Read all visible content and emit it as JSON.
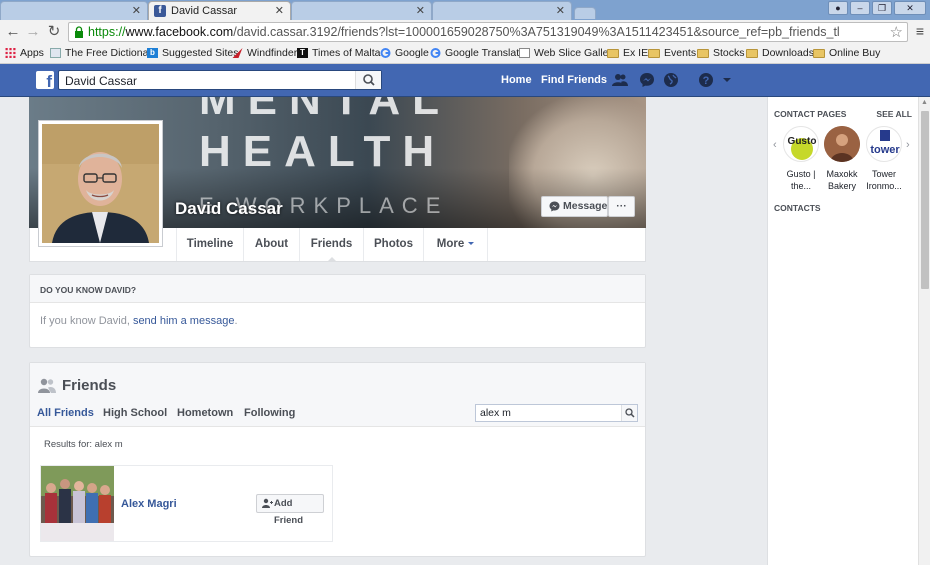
{
  "browser": {
    "tabs": [
      {
        "title": "",
        "active": false
      },
      {
        "title": "David Cassar",
        "active": true
      },
      {
        "title": "",
        "active": false
      },
      {
        "title": "",
        "active": false
      }
    ],
    "url": {
      "proto": "https://",
      "host": "www.facebook.com",
      "path": "/david.cassar.3192/friends?lst=100001659028750%3A751319049%3A1511423451&source_ref=pb_friends_tl"
    },
    "bookmarks": [
      "Apps",
      "The Free Dictionary",
      "Suggested Sites",
      "Windfinder",
      "Times of Malta",
      "Google",
      "Google Translate",
      "Web Slice Gallery",
      "Ex IE",
      "Events",
      "Stocks",
      "Downloads",
      "Online Buy"
    ]
  },
  "fb_header": {
    "search_value": "David Cassar",
    "links": [
      "Home",
      "Find Friends"
    ]
  },
  "profile": {
    "name": "David Cassar",
    "cover_text": [
      "MENTAL",
      "HEALTH",
      "E WORKPLACE"
    ],
    "message_button": "Message",
    "more_button": "···",
    "tabs": [
      "Timeline",
      "About",
      "Friends",
      "Photos",
      "More"
    ],
    "active_tab": "Friends"
  },
  "know_card": {
    "heading": "DO YOU KNOW DAVID?",
    "text_prefix": "If you know David, ",
    "link_text": "send him a message",
    "text_suffix": "."
  },
  "friends": {
    "title": "Friends",
    "tabs": [
      "All Friends",
      "High School",
      "Hometown",
      "Following"
    ],
    "active_tab": "All Friends",
    "search_value": "alex m",
    "results_label": "Results for: alex m",
    "results": [
      {
        "name": "Alex Magri",
        "action": "Add Friend"
      }
    ]
  },
  "sidebar": {
    "contact_pages_label": "CONTACT PAGES",
    "see_all_label": "SEE ALL",
    "pages": [
      {
        "line1": "Gusto |",
        "line2": "the...",
        "logo_text": "Gusto"
      },
      {
        "line1": "Maxokk",
        "line2": "Bakery",
        "logo_text": ""
      },
      {
        "line1": "Tower",
        "line2": "Ironmo...",
        "logo_text": "tower"
      }
    ],
    "contacts_label": "CONTACTS"
  },
  "colors": {
    "fb_blue": "#4267b2",
    "link_blue": "#365899",
    "page_bg": "#e9ebee"
  }
}
